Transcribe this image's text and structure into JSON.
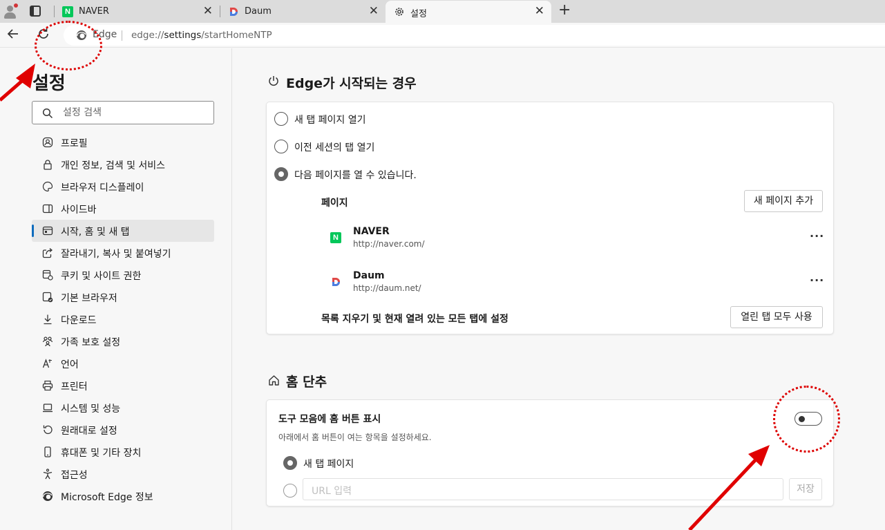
{
  "browser": {
    "tabs": [
      {
        "title": "NAVER",
        "favicon": "naver-favicon"
      },
      {
        "title": "Daum",
        "favicon": "daum-favicon"
      },
      {
        "title": "설정",
        "favicon": "gear-icon"
      }
    ],
    "tab_close": "✕",
    "new_tab": "+",
    "edge_label": "Edge",
    "url_prefix": "edge://",
    "url_bold": "settings",
    "url_suffix": "/startHomeNTP"
  },
  "sidebar": {
    "title": "설정",
    "search_placeholder": "설정 검색",
    "items": [
      {
        "label": "프로필",
        "icon": "profile-icon"
      },
      {
        "label": "개인 정보, 검색 및 서비스",
        "icon": "lock-icon"
      },
      {
        "label": "브라우저 디스플레이",
        "icon": "palette-icon"
      },
      {
        "label": "사이드바",
        "icon": "sidebar-icon"
      },
      {
        "label": "시작, 홈 및 새 탭",
        "icon": "home-tab-icon",
        "selected": true
      },
      {
        "label": "잘라내기, 복사 및 붙여넣기",
        "icon": "share-icon"
      },
      {
        "label": "쿠키 및 사이트 권한",
        "icon": "cookie-icon"
      },
      {
        "label": "기본 브라우저",
        "icon": "browser-icon"
      },
      {
        "label": "다운로드",
        "icon": "download-icon"
      },
      {
        "label": "가족 보호 설정",
        "icon": "family-icon"
      },
      {
        "label": "언어",
        "icon": "language-icon"
      },
      {
        "label": "프린터",
        "icon": "printer-icon"
      },
      {
        "label": "시스템 및 성능",
        "icon": "laptop-icon"
      },
      {
        "label": "원래대로 설정",
        "icon": "reset-icon"
      },
      {
        "label": "휴대폰 및 기타 장치",
        "icon": "phone-icon"
      },
      {
        "label": "접근성",
        "icon": "accessibility-icon"
      },
      {
        "label": "Microsoft Edge 정보",
        "icon": "edge-icon"
      }
    ]
  },
  "startup": {
    "title": "Edge가 시작되는 경우",
    "options": [
      {
        "label": "새 탭 페이지 열기",
        "selected": false
      },
      {
        "label": "이전 세션의 탭 열기",
        "selected": false
      },
      {
        "label": "다음 페이지를 열 수 있습니다.",
        "selected": true
      }
    ],
    "pages_label": "페이지",
    "add_page_button": "새 페이지 추가",
    "pages": [
      {
        "name": "NAVER",
        "url": "http://naver.com/"
      },
      {
        "name": "Daum",
        "url": "http://daum.net/"
      }
    ],
    "more_label": "···",
    "clear_label": "목록 지우기 및 현재 열려 있는 모든 탭에 설정",
    "use_open_tabs_button": "열린 탭 모두 사용"
  },
  "home": {
    "title": "홈 단추",
    "show_home_label": "도구 모음에 홈 버튼 표시",
    "show_home_desc": "아래에서 홈 버튼이 여는 항목을 설정하세요.",
    "toggle_on": false,
    "options": [
      {
        "label": "새 탭 페이지",
        "selected": true
      }
    ],
    "url_placeholder": "URL 입력",
    "save_button": "저장"
  },
  "colors": {
    "accent": "#0f6cbd",
    "annotation": "#dd0000"
  }
}
